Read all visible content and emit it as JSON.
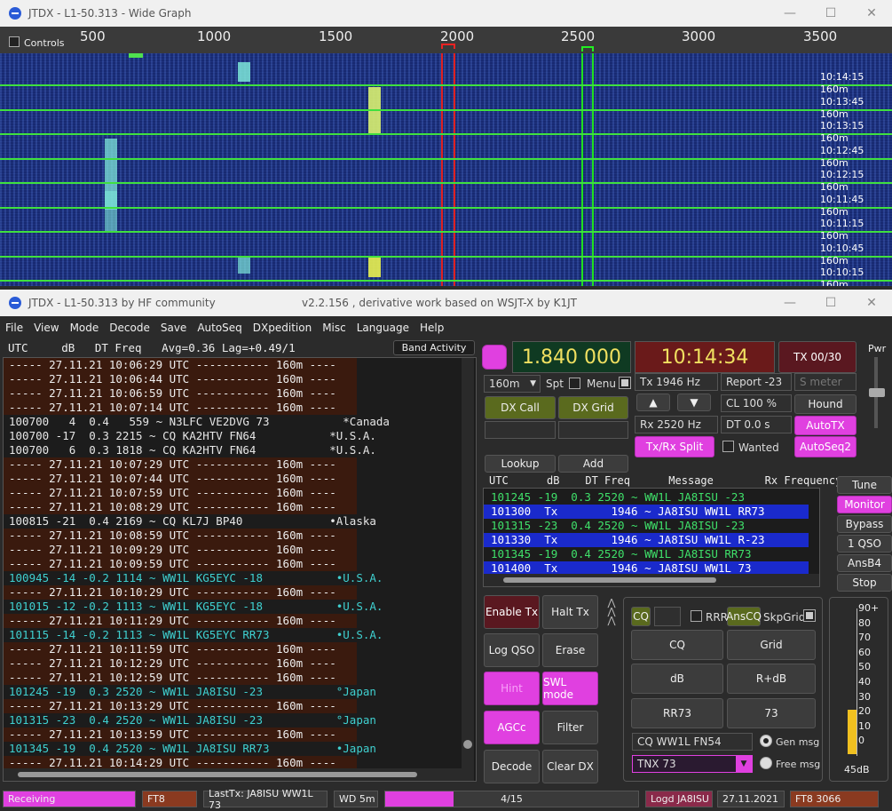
{
  "wide_graph": {
    "title": "JTDX - L1-50.313 - Wide Graph",
    "controls_label": "Controls",
    "freq_ticks": [
      "500",
      "1000",
      "1500",
      "2000",
      "2500",
      "3000",
      "3500"
    ],
    "time_rows": [
      {
        "time": "10:14:15",
        "band": "160m"
      },
      {
        "time": "10:13:45",
        "band": "160m"
      },
      {
        "time": "10:13:15",
        "band": "160m"
      },
      {
        "time": "10:12:45",
        "band": "160m"
      },
      {
        "time": "10:12:15",
        "band": "160m"
      },
      {
        "time": "10:11:45",
        "band": "160m"
      },
      {
        "time": "10:11:15",
        "band": "160m"
      },
      {
        "time": "10:10:45",
        "band": "160m"
      },
      {
        "time": "10:10:15",
        "band": "160m"
      }
    ]
  },
  "main": {
    "title": "JTDX - L1-50.313  by HF community",
    "version": "v2.2.156 , derivative work based on WSJT-X by K1JT",
    "menu": [
      "File",
      "View",
      "Mode",
      "Decode",
      "Save",
      "AutoSeq",
      "DXpedition",
      "Misc",
      "Language",
      "Help"
    ],
    "band_header": "UTC     dB   DT Freq   Avg=0.36 Lag=+0.49/1",
    "band_activity_label": "Band Activity",
    "band_rows": [
      {
        "t": "sep",
        "text": "----- 27.11.21 10:06:29 UTC ----------- 160m ----"
      },
      {
        "t": "sep",
        "text": "----- 27.11.21 10:06:44 UTC ----------- 160m ----"
      },
      {
        "t": "sep",
        "text": "----- 27.11.21 10:06:59 UTC ----------- 160m ----"
      },
      {
        "t": "sep",
        "text": "----- 27.11.21 10:07:14 UTC ----------- 160m ----"
      },
      {
        "t": "plain",
        "text": "100700   4  0.4   559 ~ N3LFC VE2DVG 73           *Canada"
      },
      {
        "t": "plain",
        "text": "100700 -17  0.3 2215 ~ CQ KA2HTV FN64           *U.S.A."
      },
      {
        "t": "plain",
        "text": "100700   6  0.3 1818 ~ CQ KA2HTV FN64           *U.S.A."
      },
      {
        "t": "sep",
        "text": "----- 27.11.21 10:07:29 UTC ----------- 160m ----"
      },
      {
        "t": "sep",
        "text": "----- 27.11.21 10:07:44 UTC ----------- 160m ----"
      },
      {
        "t": "sep",
        "text": "----- 27.11.21 10:07:59 UTC ----------- 160m ----"
      },
      {
        "t": "sep",
        "text": "----- 27.11.21 10:08:29 UTC ----------- 160m ----"
      },
      {
        "t": "plain",
        "text": "100815 -21  0.4 2169 ~ CQ KL7J BP40             •Alaska"
      },
      {
        "t": "sep",
        "text": "----- 27.11.21 10:08:59 UTC ----------- 160m ----"
      },
      {
        "t": "sep",
        "text": "----- 27.11.21 10:09:29 UTC ----------- 160m ----"
      },
      {
        "t": "sep",
        "text": "----- 27.11.21 10:09:59 UTC ----------- 160m ----"
      },
      {
        "t": "cyan",
        "text": "100945 -14 -0.2 1114 ~ WW1L KG5EYC -18           •U.S.A."
      },
      {
        "t": "sep",
        "text": "----- 27.11.21 10:10:29 UTC ----------- 160m ----"
      },
      {
        "t": "cyan",
        "text": "101015 -12 -0.2 1113 ~ WW1L KG5EYC -18           •U.S.A."
      },
      {
        "t": "sep",
        "text": "----- 27.11.21 10:11:29 UTC ----------- 160m ----"
      },
      {
        "t": "cyan",
        "text": "101115 -14 -0.2 1113 ~ WW1L KG5EYC RR73          •U.S.A."
      },
      {
        "t": "sep",
        "text": "----- 27.11.21 10:11:59 UTC ----------- 160m ----"
      },
      {
        "t": "sep",
        "text": "----- 27.11.21 10:12:29 UTC ----------- 160m ----"
      },
      {
        "t": "sep",
        "text": "----- 27.11.21 10:12:59 UTC ----------- 160m ----"
      },
      {
        "t": "cyan",
        "text": "101245 -19  0.3 2520 ~ WW1L JA8ISU -23           °Japan"
      },
      {
        "t": "sep",
        "text": "----- 27.11.21 10:13:29 UTC ----------- 160m ----"
      },
      {
        "t": "cyan",
        "text": "101315 -23  0.4 2520 ~ WW1L JA8ISU -23           °Japan"
      },
      {
        "t": "sep",
        "text": "----- 27.11.21 10:13:59 UTC ----------- 160m ----"
      },
      {
        "t": "cyan",
        "text": "101345 -19  0.4 2520 ~ WW1L JA8ISU RR73          •Japan"
      },
      {
        "t": "sep",
        "text": "----- 27.11.21 10:14:29 UTC ----------- 160m ----"
      }
    ],
    "dial_freq": "1.840 000",
    "utc_time": "10:14:34",
    "tx_counter": "TX 00/30",
    "pwr_label": "Pwr",
    "band_select": "160m",
    "spt_label": "Spt",
    "menu_label": "Menu",
    "tx_freq": "Tx  1946  Hz",
    "report": "Report -23",
    "smeter_placeholder": "S meter",
    "dx_call_btn": "DX Call",
    "dx_grid_btn": "DX Grid",
    "cl_value": "CL  100 %",
    "hound_btn": "Hound",
    "rx_freq": "Rx  2520  Hz",
    "dt_value": "DT 0.0 s",
    "autotx_btn": "AutoTX",
    "txrx_split_btn": "Tx/Rx Split",
    "wanted_label": "Wanted",
    "autoseq2_btn": "AutoSeq2",
    "lookup_btn": "Lookup",
    "add_btn": "Add",
    "rx_header": "UTC      dB    DT Freq      Message        Rx Frequency",
    "rx_rows": [
      {
        "t": "green",
        "text": "101245 -19  0.3 2520 ~ WW1L JA8ISU -23"
      },
      {
        "t": "tx",
        "text": "101300  Tx        1946 ~ JA8ISU WW1L RR73"
      },
      {
        "t": "green",
        "text": "101315 -23  0.4 2520 ~ WW1L JA8ISU -23"
      },
      {
        "t": "tx",
        "text": "101330  Tx        1946 ~ JA8ISU WW1L R-23"
      },
      {
        "t": "green",
        "text": "101345 -19  0.4 2520 ~ WW1L JA8ISU RR73"
      },
      {
        "t": "tx",
        "text": "101400  Tx        1946 ~ JA8ISU WW1L 73"
      }
    ],
    "side_buttons": [
      "Tune",
      "Monitor",
      "Bypass",
      "1 QSO",
      "AnsB4",
      "Stop"
    ],
    "enable_tx_btn": "Enable Tx",
    "halt_tx_btn": "Halt Tx",
    "log_qso_btn": "Log QSO",
    "erase_btn": "Erase",
    "hint_btn": "Hint",
    "swl_btn": "SWL mode",
    "agcc_btn": "AGCc",
    "filter_btn": "Filter",
    "decode_btn": "Decode",
    "clear_dx_btn": "Clear DX",
    "cq_toggle": "CQ",
    "rrr_label": "RRR",
    "anscq_btn": "AnsCQ",
    "skpgrid_label": "SkpGrid",
    "msg_buttons": [
      "CQ",
      "Grid",
      "dB",
      "R+dB",
      "RR73",
      "73"
    ],
    "cq_message": "CQ WW1L FN54",
    "gen_msg_label": "Gen msg",
    "tnx_select": "TNX 73",
    "free_msg_label": "Free msg",
    "meter_ticks": [
      "90+",
      "80",
      "70",
      "60",
      "50",
      "40",
      "30",
      "20",
      "10",
      "0"
    ],
    "meter_db": "45dB",
    "meter_level_db": 45,
    "status": {
      "receiving": "Receiving",
      "mode": "FT8",
      "last_tx": "LastTx: JA8ISU WW1L 73",
      "wd": "WD 5m",
      "progress": "4/15",
      "progress_fraction": 0.27,
      "logd": "Logd JA8ISU",
      "date": "27.11.2021",
      "mode_freq": "FT8  3066"
    }
  }
}
